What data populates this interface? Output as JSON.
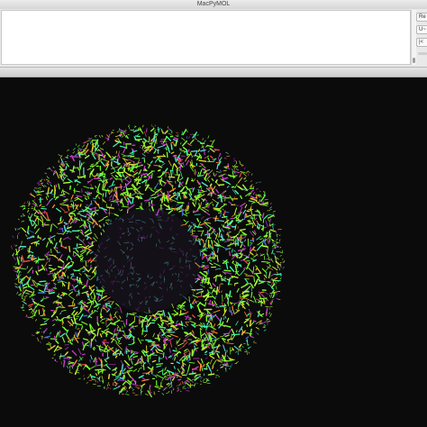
{
  "window": {
    "title": "MacPyMOL"
  },
  "side_buttons": [
    "Re",
    "U~",
    "|<"
  ],
  "viewer": {
    "background_color": "#0b0b0b",
    "molecule_colors": [
      "#7cff2a",
      "#b8ff3a",
      "#38ffb0",
      "#5ad8d2",
      "#e2d42a",
      "#c83cc8",
      "#9b2ea6",
      "#e64646",
      "#ff8a30",
      "#3c6ed6"
    ]
  }
}
